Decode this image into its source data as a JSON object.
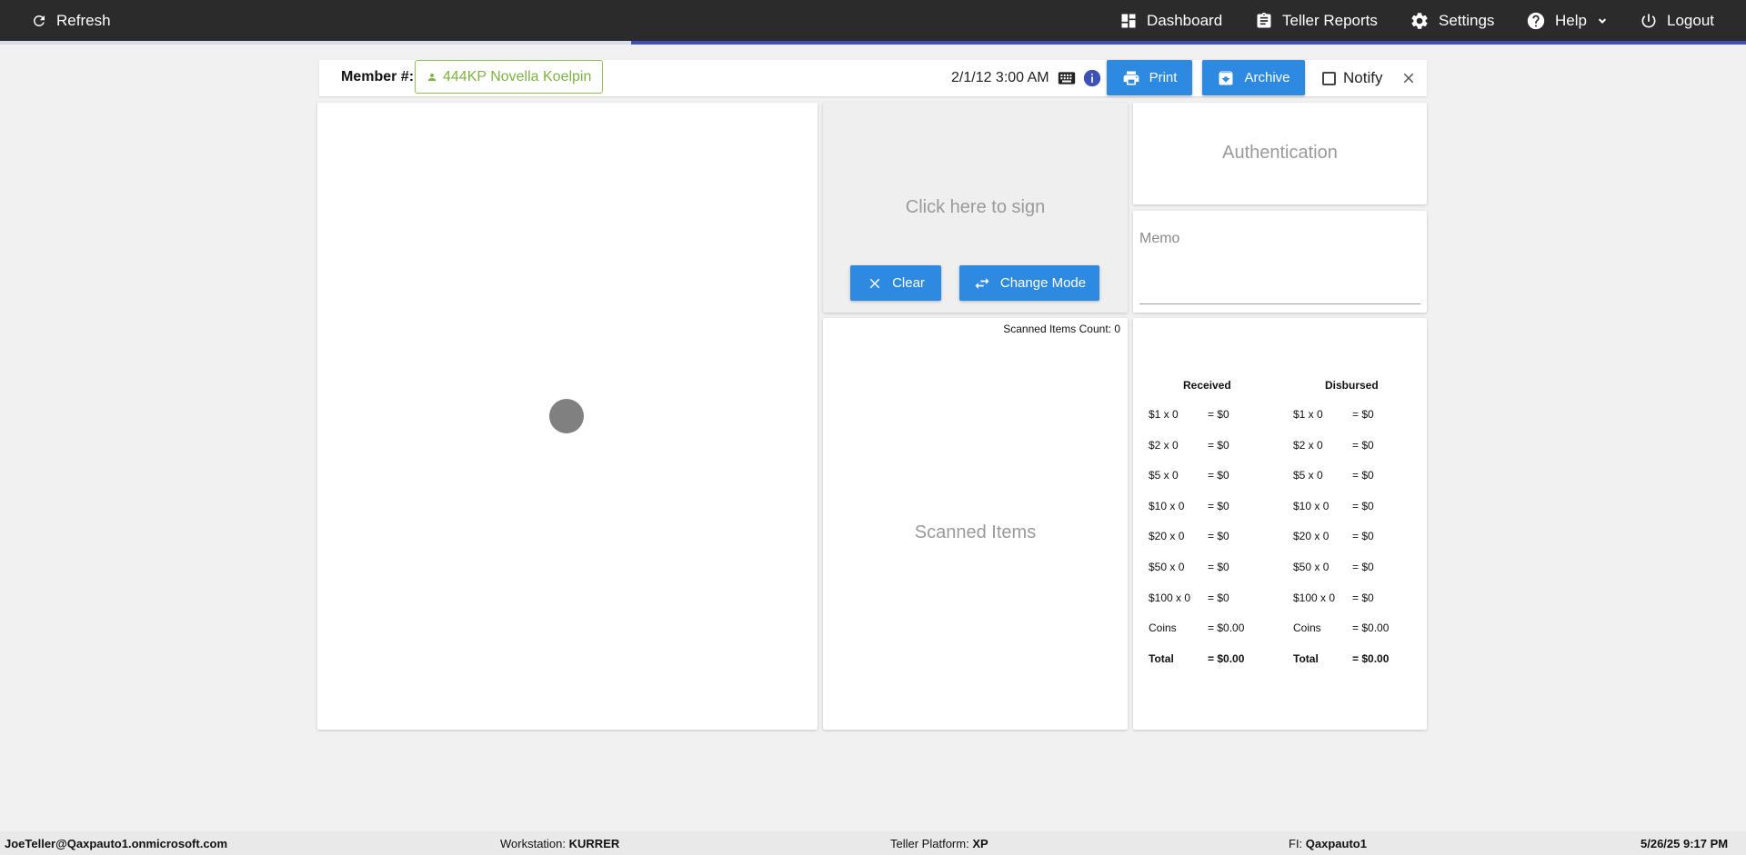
{
  "topbar": {
    "refresh": "Refresh",
    "dashboard": "Dashboard",
    "teller_reports": "Teller Reports",
    "settings": "Settings",
    "help": "Help",
    "logout": "Logout"
  },
  "header": {
    "member_label": "Member #:",
    "member_value": "444KP Novella Koelpin",
    "datetime": "2/1/12 3:00 AM",
    "print": "Print",
    "archive": "Archive",
    "notify": "Notify"
  },
  "signature": {
    "prompt": "Click here to sign",
    "clear": "Clear",
    "change_mode": "Change Mode"
  },
  "authentication": {
    "label": "Authentication"
  },
  "memo": {
    "label": "Memo"
  },
  "scanned": {
    "count_label": "Scanned Items Count: 0",
    "label": "Scanned Items"
  },
  "cash": {
    "received_header": "Received",
    "disbursed_header": "Disbursed",
    "received": [
      {
        "denom": "$1 x 0",
        "amount": "= $0"
      },
      {
        "denom": "$2 x 0",
        "amount": "= $0"
      },
      {
        "denom": "$5 x 0",
        "amount": "= $0"
      },
      {
        "denom": "$10 x 0",
        "amount": "= $0"
      },
      {
        "denom": "$20 x 0",
        "amount": "= $0"
      },
      {
        "denom": "$50 x 0",
        "amount": "= $0"
      },
      {
        "denom": "$100 x 0",
        "amount": "= $0"
      },
      {
        "denom": "Coins",
        "amount": "= $0.00"
      },
      {
        "denom": "Total",
        "amount": "= $0.00"
      }
    ],
    "disbursed": [
      {
        "denom": "$1 x 0",
        "amount": "= $0"
      },
      {
        "denom": "$2 x 0",
        "amount": "= $0"
      },
      {
        "denom": "$5 x 0",
        "amount": "= $0"
      },
      {
        "denom": "$10 x 0",
        "amount": "= $0"
      },
      {
        "denom": "$20 x 0",
        "amount": "= $0"
      },
      {
        "denom": "$50 x 0",
        "amount": "= $0"
      },
      {
        "denom": "$100 x 0",
        "amount": "= $0"
      },
      {
        "denom": "Coins",
        "amount": "= $0.00"
      },
      {
        "denom": "Total",
        "amount": "= $0.00"
      }
    ]
  },
  "footer": {
    "user": "JoeTeller@Qaxpauto1.onmicrosoft.com",
    "workstation_label": "Workstation:",
    "workstation": "KURRER",
    "platform_label": "Teller Platform:",
    "platform": "XP",
    "fi_label": "FI:",
    "fi": "Qaxpauto1",
    "timestamp": "5/26/25 9:17 PM"
  }
}
